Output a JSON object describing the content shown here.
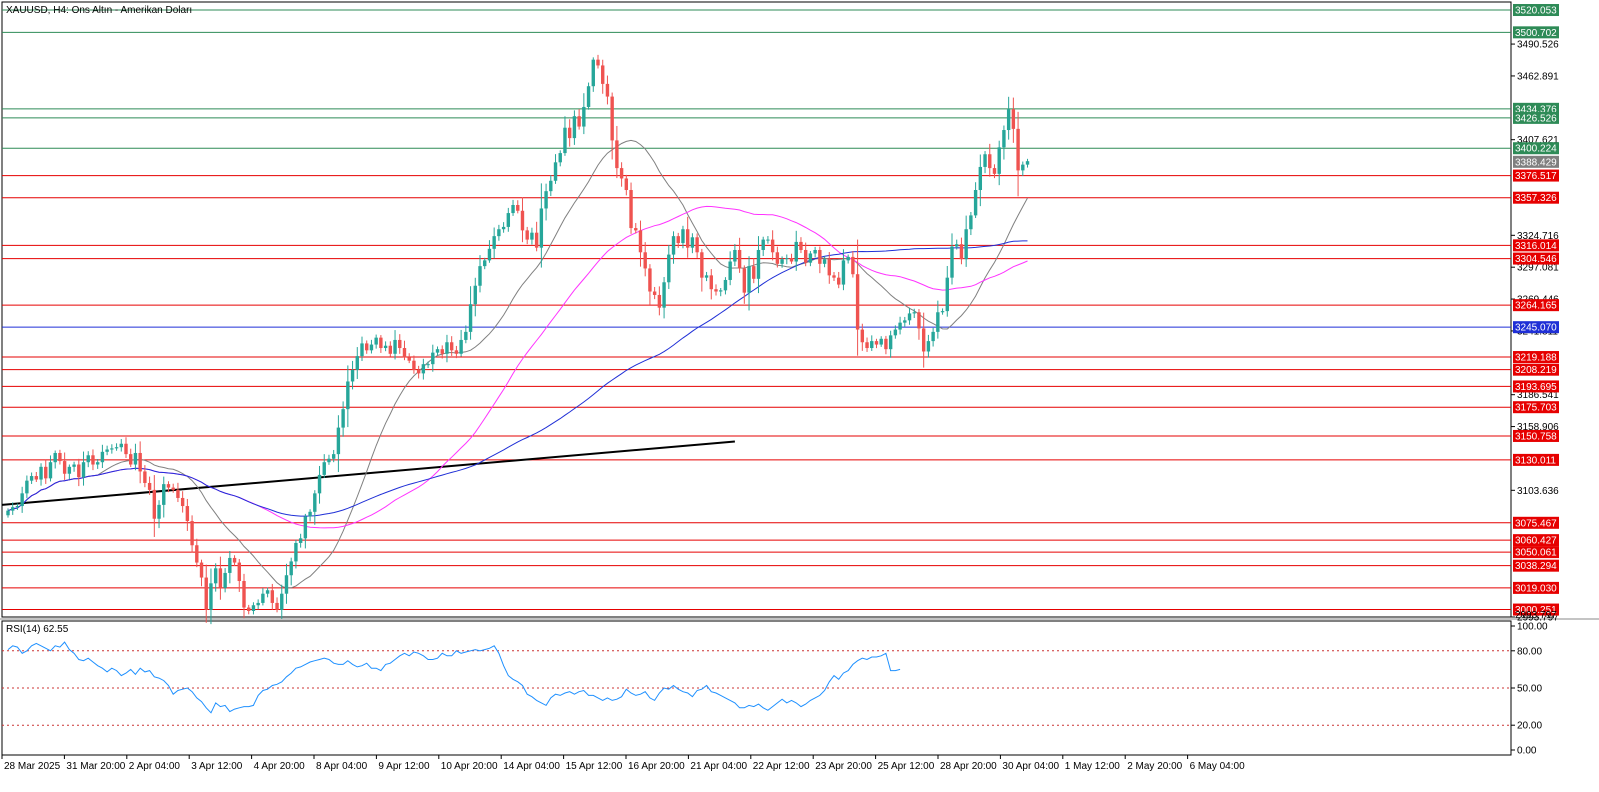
{
  "header": {
    "title": "XAUUSD, H4:  Ons Altın - Amerikan Doları"
  },
  "rsi": {
    "label": "RSI(14) 62.55",
    "levels": [
      "100.00",
      "80.00",
      "50.00",
      "20.00",
      "0.00"
    ],
    "values": [
      81,
      84,
      83,
      78,
      80,
      84,
      86,
      84,
      82,
      80,
      84,
      83,
      87,
      81,
      78,
      73,
      72,
      74,
      71,
      68,
      66,
      63,
      66,
      64,
      60,
      62,
      65,
      61,
      66,
      63,
      64,
      59,
      58,
      56,
      52,
      45,
      48,
      49,
      50,
      47,
      42,
      39,
      34,
      30,
      38,
      35,
      36,
      31,
      33,
      34,
      35,
      35,
      36,
      44,
      48,
      49,
      52,
      53,
      55,
      59,
      62,
      66,
      67,
      69,
      71,
      72,
      73,
      74,
      73,
      70,
      69,
      69,
      72,
      69,
      67,
      68,
      70,
      66,
      66,
      64,
      69,
      70,
      73,
      76,
      78,
      76,
      79,
      78,
      76,
      73,
      73,
      74,
      78,
      76,
      76,
      80,
      78,
      79,
      80,
      81,
      80,
      81,
      82,
      84,
      78,
      68,
      60,
      57,
      55,
      52,
      45,
      43,
      40,
      38,
      36,
      42,
      45,
      44,
      46,
      47,
      45,
      47,
      48,
      44,
      44,
      42,
      40,
      42,
      40,
      41,
      43,
      49,
      46,
      44,
      45,
      47,
      42,
      40,
      46,
      50,
      49,
      52,
      49,
      47,
      46,
      43,
      48,
      49,
      52,
      47,
      46,
      44,
      42,
      40,
      38,
      34,
      34,
      36,
      35,
      37,
      34,
      32,
      35,
      38,
      41,
      38,
      40,
      38,
      35,
      37,
      40,
      42,
      44,
      48,
      55,
      60,
      57,
      62,
      64,
      69,
      72,
      74,
      73,
      75,
      75,
      76,
      78,
      64,
      64,
      65
    ]
  },
  "chart_data": {
    "type": "candlestick",
    "symbol": "XAUUSD",
    "timeframe": "H4",
    "ylim": [
      2993.797,
      3527.0
    ],
    "x_tick_labels": [
      "28 Mar 2025",
      "31 Mar 20:00",
      "2 Apr 04:00",
      "3 Apr 12:00",
      "4 Apr 20:00",
      "8 Apr 04:00",
      "9 Apr 12:00",
      "10 Apr 20:00",
      "14 Apr 04:00",
      "15 Apr 12:00",
      "16 Apr 20:00",
      "21 Apr 04:00",
      "22 Apr 12:00",
      "23 Apr 20:00",
      "25 Apr 12:00",
      "28 Apr 20:00",
      "30 Apr 04:00",
      "1 May 12:00",
      "2 May 20:00",
      "6 May 04:00"
    ],
    "price_ticks": [
      "3490.526",
      "3462.891",
      "3407.621",
      "3324.716",
      "3297.081",
      "3269.446",
      "3241.811",
      "3186.541",
      "3158.906",
      "3103.636",
      "2993.797"
    ],
    "levels": [
      {
        "value": 3520.053,
        "label": "3520.053",
        "color": "#2e8b57"
      },
      {
        "value": 3500.702,
        "label": "3500.702",
        "color": "#2e8b57"
      },
      {
        "value": 3434.376,
        "label": "3434.376",
        "color": "#2e8b57"
      },
      {
        "value": 3426.526,
        "label": "3426.526",
        "color": "#2e8b57"
      },
      {
        "value": 3400.224,
        "label": "3400.224",
        "color": "#2e8b57"
      },
      {
        "value": 3376.517,
        "label": "3376.517",
        "color": "#e60000"
      },
      {
        "value": 3357.326,
        "label": "3357.326",
        "color": "#e60000"
      },
      {
        "value": 3316.014,
        "label": "3316.014",
        "color": "#e60000"
      },
      {
        "value": 3304.546,
        "label": "3304.546",
        "color": "#e60000"
      },
      {
        "value": 3264.165,
        "label": "3264.165",
        "color": "#e60000"
      },
      {
        "value": 3245.07,
        "label": "3245.070",
        "color": "#1f2fd6"
      },
      {
        "value": 3219.188,
        "label": "3219.188",
        "color": "#e60000"
      },
      {
        "value": 3208.219,
        "label": "3208.219",
        "color": "#e60000"
      },
      {
        "value": 3193.695,
        "label": "3193.695",
        "color": "#e60000"
      },
      {
        "value": 3175.703,
        "label": "3175.703",
        "color": "#e60000"
      },
      {
        "value": 3150.758,
        "label": "3150.758",
        "color": "#e60000"
      },
      {
        "value": 3130.011,
        "label": "3130.011",
        "color": "#e60000"
      },
      {
        "value": 3075.467,
        "label": "3075.467",
        "color": "#e60000"
      },
      {
        "value": 3060.427,
        "label": "3060.427",
        "color": "#e60000"
      },
      {
        "value": 3050.061,
        "label": "3050.061",
        "color": "#e60000"
      },
      {
        "value": 3038.294,
        "label": "3038.294",
        "color": "#e60000"
      },
      {
        "value": 3019.03,
        "label": "3019.030",
        "color": "#e60000"
      },
      {
        "value": 3000.251,
        "label": "3000.251",
        "color": "#e60000"
      }
    ],
    "current_price": {
      "value": 3388.429,
      "label": "3388.429",
      "color": "#7f7f7f"
    },
    "bottom_price_label": "2993.797",
    "colors": {
      "up": "#26a69a",
      "down": "#ef5350",
      "sma_fast": "#808080",
      "sma_mid": "#ff33ff",
      "sma_slow": "#1f2fd6",
      "trendline": "#000000",
      "rsi": "#1e90ff"
    },
    "trendline": [
      {
        "t": 0,
        "price": 3091
      },
      {
        "t": 154,
        "price": 3146
      }
    ],
    "close": [
      3086,
      3089,
      3090,
      3101,
      3112,
      3116,
      3113,
      3124,
      3114,
      3128,
      3136,
      3129,
      3118,
      3124,
      3126,
      3115,
      3128,
      3134,
      3126,
      3128,
      3137,
      3139,
      3140,
      3141,
      3144,
      3135,
      3126,
      3136,
      3120,
      3110,
      3104,
      3079,
      3091,
      3109,
      3106,
      3104,
      3097,
      3090,
      3077,
      3056,
      3041,
      3028,
      3000,
      3023,
      3036,
      3019,
      3032,
      3045,
      3041,
      3025,
      3002,
      2999,
      3004,
      3006,
      3014,
      3017,
      3006,
      3000,
      3014,
      3030,
      3042,
      3058,
      3062,
      3081,
      3085,
      3101,
      3117,
      3128,
      3131,
      3135,
      3158,
      3174,
      3198,
      3208,
      3220,
      3231,
      3225,
      3230,
      3236,
      3227,
      3229,
      3222,
      3234,
      3227,
      3219,
      3216,
      3208,
      3205,
      3213,
      3213,
      3223,
      3226,
      3222,
      3232,
      3225,
      3222,
      3234,
      3241,
      3265,
      3281,
      3298,
      3303,
      3313,
      3324,
      3330,
      3332,
      3344,
      3351,
      3346,
      3329,
      3321,
      3327,
      3314,
      3348,
      3363,
      3372,
      3388,
      3396,
      3418,
      3409,
      3428,
      3419,
      3436,
      3454,
      3477,
      3472,
      3456,
      3445,
      3407,
      3383,
      3374,
      3364,
      3331,
      3329,
      3310,
      3296,
      3276,
      3273,
      3262,
      3284,
      3308,
      3324,
      3318,
      3330,
      3314,
      3323,
      3310,
      3288,
      3290,
      3278,
      3276,
      3277,
      3286,
      3302,
      3312,
      3296,
      3275,
      3298,
      3287,
      3312,
      3321,
      3321,
      3310,
      3300,
      3304,
      3305,
      3302,
      3319,
      3312,
      3301,
      3309,
      3312,
      3300,
      3304,
      3290,
      3288,
      3282,
      3303,
      3306,
      3291,
      3243,
      3232,
      3227,
      3233,
      3230,
      3235,
      3226,
      3238,
      3243,
      3249,
      3251,
      3257,
      3258,
      3244,
      3224,
      3233,
      3241,
      3258,
      3259,
      3288,
      3315,
      3317,
      3304,
      3330,
      3342,
      3364,
      3384,
      3395,
      3383,
      3378,
      3401,
      3416,
      3434,
      3417,
      3381,
      3386,
      3389
    ]
  }
}
